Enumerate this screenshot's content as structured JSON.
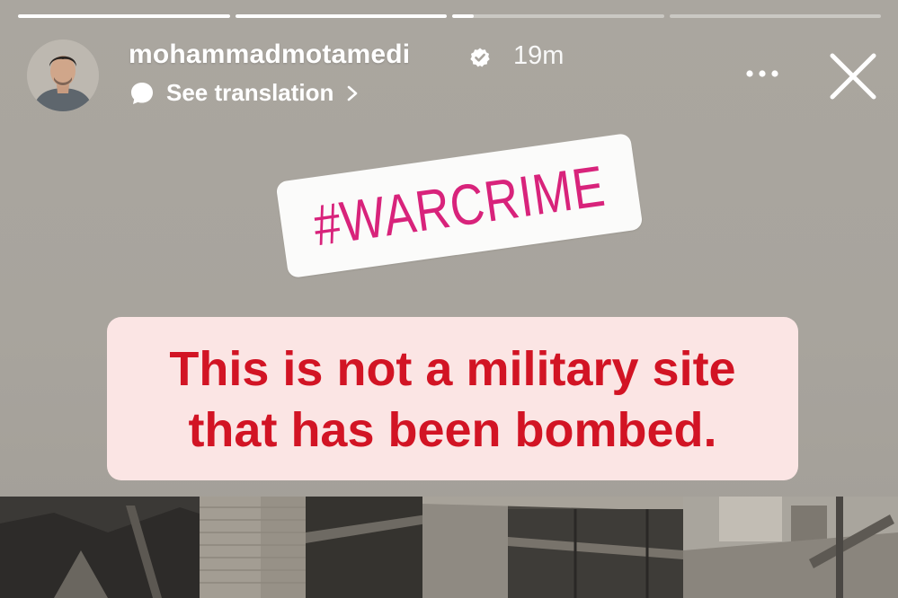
{
  "story": {
    "username": "mohammadmotamedi",
    "time_ago": "19m",
    "translation_label": "See translation",
    "progress": [
      1.0,
      1.0,
      0.1,
      0.0
    ]
  },
  "icons": {
    "verified": "verified-badge-icon",
    "translation": "speech-bubble-icon",
    "chevron": "chevron-right-icon",
    "more": "more-options-icon",
    "close": "close-icon"
  },
  "sticker": {
    "text": "#WARCRIME",
    "color": "#d8237b"
  },
  "caption": {
    "line1": "This is not a military site",
    "line2": "that has been bombed.",
    "text_color": "#d21424",
    "background": "#fbe5e4"
  },
  "colors": {
    "background": "#a8a49d"
  }
}
